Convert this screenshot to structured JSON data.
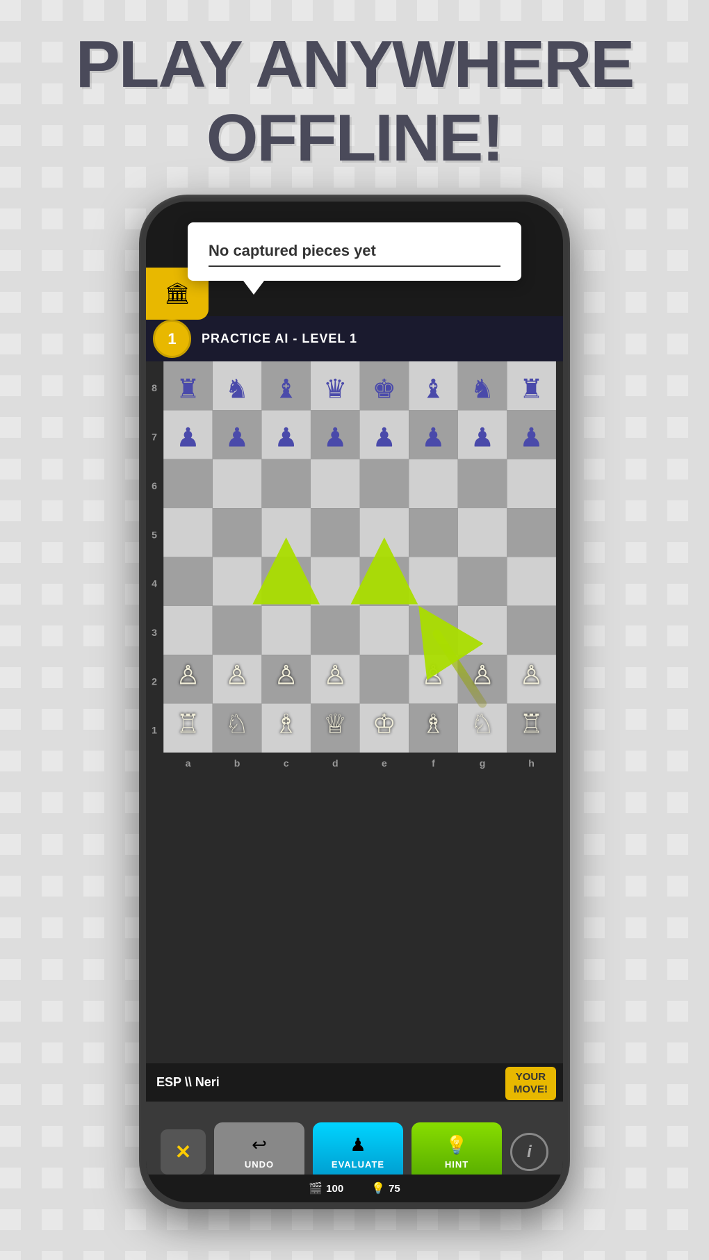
{
  "headline": {
    "line1": "PLAY ANYWHERE",
    "line2": "OFFLINE!"
  },
  "tooltip": {
    "text": "No captured pieces yet",
    "underline": true
  },
  "game": {
    "mode_label": "PRACTICE AI - LEVEL 1",
    "level_num": "1",
    "player_name": "ESP \\\\ Neri",
    "your_move_label": "YOUR\nMOVE!"
  },
  "buttons": {
    "close_label": "✕",
    "undo_label": "UNDO",
    "evaluate_label": "EVALUATE",
    "hint_label": "HINT",
    "info_label": "i"
  },
  "status_bar": {
    "coins_icon": "🎬",
    "coins_val": "100",
    "lightning_icon": "💡",
    "lightning_val": "75"
  },
  "board": {
    "rows": [
      "8",
      "7",
      "6",
      "5",
      "4",
      "3",
      "2",
      "1"
    ],
    "cols": [
      "a",
      "b",
      "c",
      "d",
      "e",
      "f",
      "g",
      "h"
    ]
  }
}
